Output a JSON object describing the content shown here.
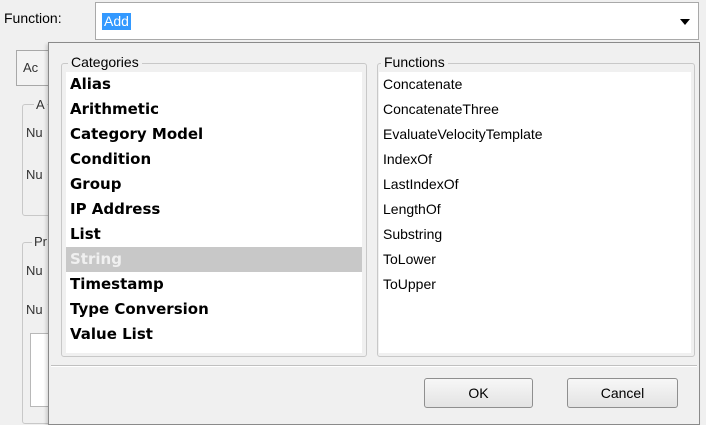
{
  "function_row": {
    "label": "Function:",
    "value": "Add"
  },
  "background": {
    "first_button": "Ac",
    "section1_title": "A",
    "section1_row1": "Nu",
    "section1_row2": "Nu",
    "section2_title": "Pr",
    "section2_row1": "Nu",
    "section2_row2": "Nu"
  },
  "popup": {
    "categories_title": "Categories",
    "functions_title": "Functions",
    "categories": [
      "Alias",
      "Arithmetic",
      "Category Model",
      "Condition",
      "Group",
      "IP Address",
      "List",
      "String",
      "Timestamp",
      "Type Conversion",
      "Value List"
    ],
    "selected_category": "String",
    "functions": [
      "Concatenate",
      "ConcatenateThree",
      "EvaluateVelocityTemplate",
      "IndexOf",
      "LastIndexOf",
      "LengthOf",
      "Substring",
      "ToLower",
      "ToUpper"
    ],
    "ok_label": "OK",
    "cancel_label": "Cancel"
  }
}
